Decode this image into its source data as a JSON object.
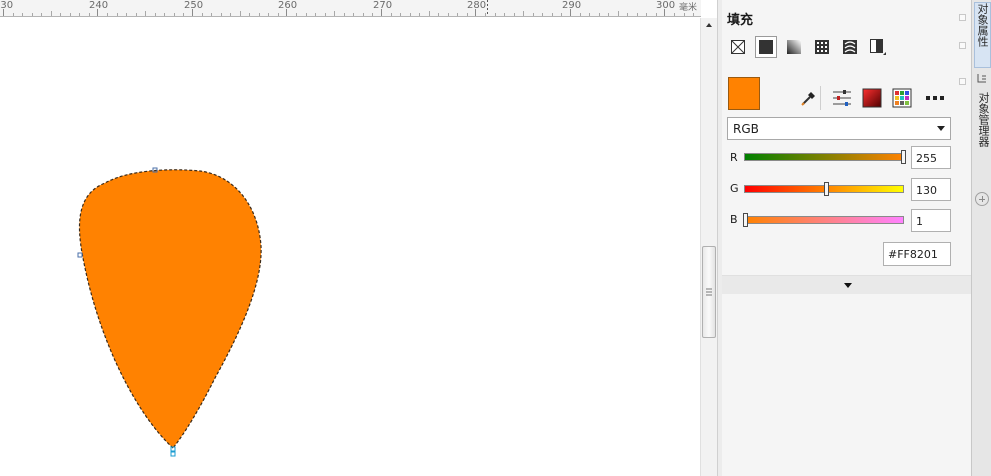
{
  "ruler": {
    "ticks": [
      "230",
      "240",
      "250",
      "260",
      "270",
      "280",
      "290",
      "300"
    ],
    "unit": "毫米"
  },
  "panel": {
    "title": "填充",
    "fill_types": [
      "no-fill-icon",
      "uniform-fill-icon",
      "fountain-fill-icon",
      "pattern-fill-icon",
      "texture-fill-icon",
      "postscript-fill-icon"
    ],
    "active_fill_type": "uniform-fill-icon",
    "color_hex_swatch": "#FF8201",
    "tools": [
      "eyedropper-icon",
      "color-sliders-icon",
      "color-viewer-icon",
      "color-palettes-icon",
      "more-options-icon"
    ],
    "color_model": "RGB",
    "channels": [
      {
        "label": "R",
        "value": "255"
      },
      {
        "label": "G",
        "value": "130"
      },
      {
        "label": "B",
        "value": "1"
      }
    ],
    "hex_value": "#FF8201"
  },
  "dock": {
    "tabs": [
      "对象属性",
      "对象管理器"
    ]
  },
  "colors": {
    "shape_fill": "#FF8201",
    "shape_outline": "#3a2a1a"
  }
}
